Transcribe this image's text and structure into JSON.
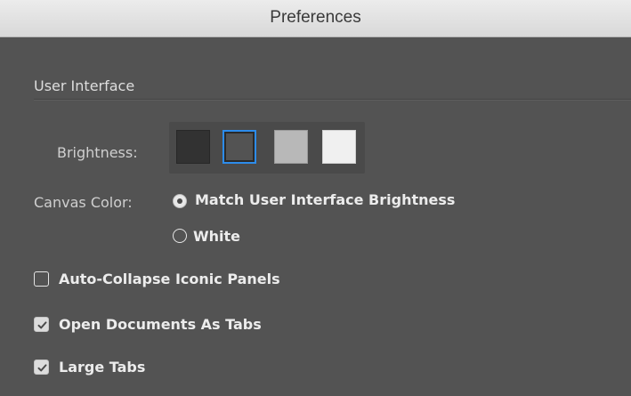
{
  "window": {
    "title": "Preferences"
  },
  "section": {
    "heading": "User Interface"
  },
  "brightness": {
    "label": "Brightness:",
    "options": [
      {
        "name": "dark",
        "color": "#323232",
        "selected": false
      },
      {
        "name": "medium-dark",
        "color": "#535353",
        "selected": true
      },
      {
        "name": "medium-light",
        "color": "#b8b8b8",
        "selected": false
      },
      {
        "name": "light",
        "color": "#f0f0f0",
        "selected": false
      }
    ],
    "selection_color": "#2d8ceb"
  },
  "canvas_color": {
    "label": "Canvas Color:",
    "options": [
      {
        "label": "Match User Interface Brightness",
        "selected": true
      },
      {
        "label": "White",
        "selected": false
      }
    ]
  },
  "checkboxes": [
    {
      "label": "Auto-Collapse Iconic Panels",
      "checked": false
    },
    {
      "label": "Open Documents As Tabs",
      "checked": true
    },
    {
      "label": "Large Tabs",
      "checked": true
    }
  ],
  "colors": {
    "panel_background": "#535353",
    "titlebar_background": "#e3e3e3"
  }
}
